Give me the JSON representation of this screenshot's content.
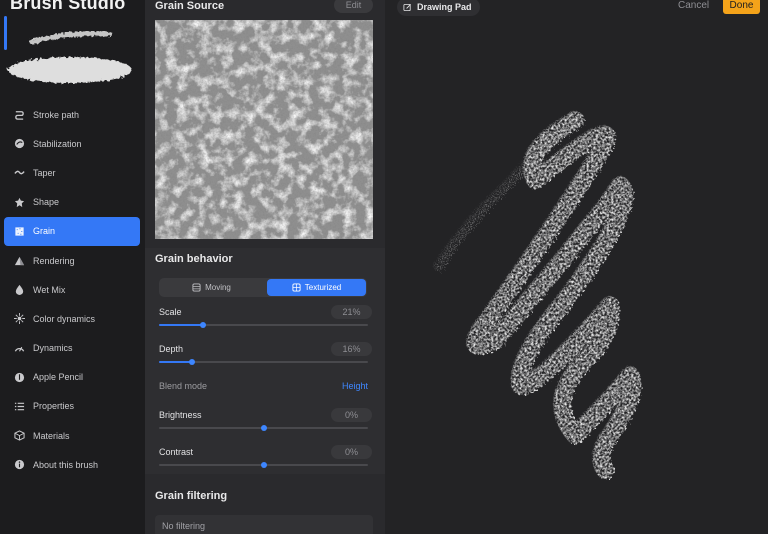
{
  "app": {
    "title": "Brush Studio"
  },
  "sidebar": {
    "active": "Grain",
    "items": [
      {
        "label": "Stroke path",
        "icon": "stroke-path-icon"
      },
      {
        "label": "Stabilization",
        "icon": "stabilization-icon"
      },
      {
        "label": "Taper",
        "icon": "taper-icon"
      },
      {
        "label": "Shape",
        "icon": "shape-icon"
      },
      {
        "label": "Grain",
        "icon": "grain-icon"
      },
      {
        "label": "Rendering",
        "icon": "rendering-icon"
      },
      {
        "label": "Wet Mix",
        "icon": "wet-mix-icon"
      },
      {
        "label": "Color dynamics",
        "icon": "color-dynamics-icon"
      },
      {
        "label": "Dynamics",
        "icon": "dynamics-icon"
      },
      {
        "label": "Apple Pencil",
        "icon": "apple-pencil-icon"
      },
      {
        "label": "Properties",
        "icon": "properties-icon"
      },
      {
        "label": "Materials",
        "icon": "materials-icon"
      },
      {
        "label": "About this brush",
        "icon": "info-icon"
      }
    ]
  },
  "grain_source": {
    "title": "Grain Source",
    "edit_label": "Edit"
  },
  "grain_behavior": {
    "title": "Grain behavior",
    "modes": [
      {
        "label": "Moving",
        "icon": "moving-icon",
        "selected": false
      },
      {
        "label": "Texturized",
        "icon": "texturized-icon",
        "selected": true
      }
    ],
    "scale": {
      "label": "Scale",
      "value_text": "21%",
      "value": 0.21
    },
    "depth": {
      "label": "Depth",
      "value_text": "16%",
      "value": 0.16
    },
    "blend_mode": {
      "label": "Blend mode",
      "value": "Height"
    },
    "brightness": {
      "label": "Brightness",
      "value_text": "0%",
      "value": 0.5
    },
    "contrast": {
      "label": "Contrast",
      "value_text": "0%",
      "value": 0.5
    }
  },
  "grain_filtering": {
    "title": "Grain filtering",
    "option": "No filtering"
  },
  "drawing_pad": {
    "title": "Drawing Pad",
    "cancel_label": "Cancel",
    "done_label": "Done"
  },
  "colors": {
    "accent": "#3478f6",
    "done": "#f4a31a",
    "link": "#3f87ff"
  }
}
